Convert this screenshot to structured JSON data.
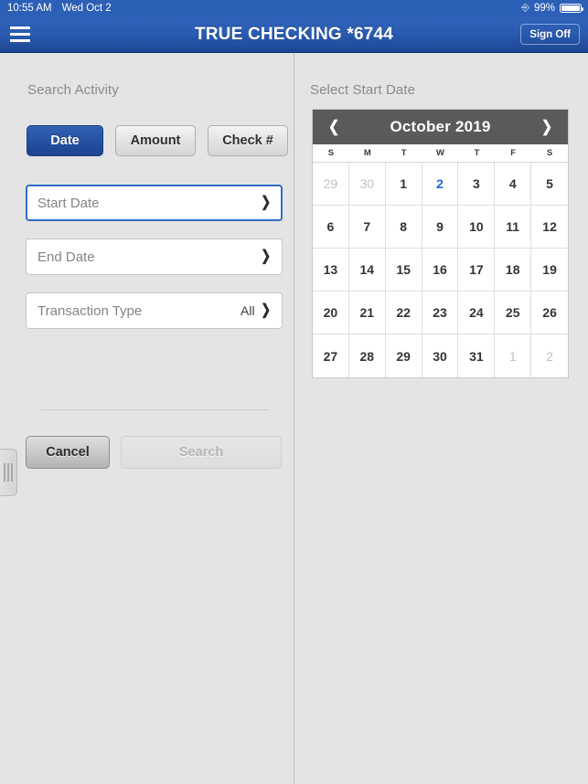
{
  "statusbar": {
    "time": "10:55 AM",
    "date": "Wed Oct 2",
    "record_icon": "screen-record-icon",
    "battery_percent": "99%"
  },
  "navbar": {
    "menu_icon": "hamburger-menu-icon",
    "title": "TRUE CHECKING *6744",
    "signoff_label": "Sign Off"
  },
  "left_panel": {
    "section_title": "Search Activity",
    "segmented": [
      {
        "label": "Date",
        "active": true
      },
      {
        "label": "Amount",
        "active": false
      },
      {
        "label": "Check #",
        "active": false
      }
    ],
    "fields": [
      {
        "label": "Start Date",
        "value": "",
        "focused": true,
        "chevron": "chevron-right-icon"
      },
      {
        "label": "End Date",
        "value": "",
        "focused": false,
        "chevron": "chevron-right-icon"
      },
      {
        "label": "Transaction Type",
        "value": "All",
        "focused": false,
        "chevron": "chevron-right-icon"
      }
    ],
    "actions": {
      "cancel_label": "Cancel",
      "search_label": "Search",
      "search_disabled": true
    },
    "drag_handle": "panel-drag-handle"
  },
  "right_panel": {
    "section_title": "Select Start Date",
    "calendar": {
      "month_year": "October 2019",
      "prev_icon": "chevron-left-icon",
      "next_icon": "chevron-right-icon",
      "day_names": [
        "S",
        "M",
        "T",
        "W",
        "T",
        "F",
        "S"
      ],
      "days": [
        {
          "n": "29",
          "state": "muted"
        },
        {
          "n": "30",
          "state": "muted"
        },
        {
          "n": "1",
          "state": "normal"
        },
        {
          "n": "2",
          "state": "today"
        },
        {
          "n": "3",
          "state": "normal"
        },
        {
          "n": "4",
          "state": "normal"
        },
        {
          "n": "5",
          "state": "normal"
        },
        {
          "n": "6",
          "state": "normal"
        },
        {
          "n": "7",
          "state": "normal"
        },
        {
          "n": "8",
          "state": "normal"
        },
        {
          "n": "9",
          "state": "normal"
        },
        {
          "n": "10",
          "state": "normal"
        },
        {
          "n": "11",
          "state": "normal"
        },
        {
          "n": "12",
          "state": "normal"
        },
        {
          "n": "13",
          "state": "normal"
        },
        {
          "n": "14",
          "state": "normal"
        },
        {
          "n": "15",
          "state": "normal"
        },
        {
          "n": "16",
          "state": "normal"
        },
        {
          "n": "17",
          "state": "normal"
        },
        {
          "n": "18",
          "state": "normal"
        },
        {
          "n": "19",
          "state": "normal"
        },
        {
          "n": "20",
          "state": "normal"
        },
        {
          "n": "21",
          "state": "normal"
        },
        {
          "n": "22",
          "state": "normal"
        },
        {
          "n": "23",
          "state": "normal"
        },
        {
          "n": "24",
          "state": "normal"
        },
        {
          "n": "25",
          "state": "normal"
        },
        {
          "n": "26",
          "state": "normal"
        },
        {
          "n": "27",
          "state": "normal"
        },
        {
          "n": "28",
          "state": "normal"
        },
        {
          "n": "29",
          "state": "normal"
        },
        {
          "n": "30",
          "state": "normal"
        },
        {
          "n": "31",
          "state": "normal"
        },
        {
          "n": "1",
          "state": "muted"
        },
        {
          "n": "2",
          "state": "muted"
        }
      ]
    }
  },
  "colors": {
    "brand_blue": "#2a5cb2",
    "accent_blue": "#2f6ccd",
    "today_blue": "#1a66d8",
    "panel_bg": "#e4e4e4",
    "calendar_header": "#5a5a5a"
  }
}
